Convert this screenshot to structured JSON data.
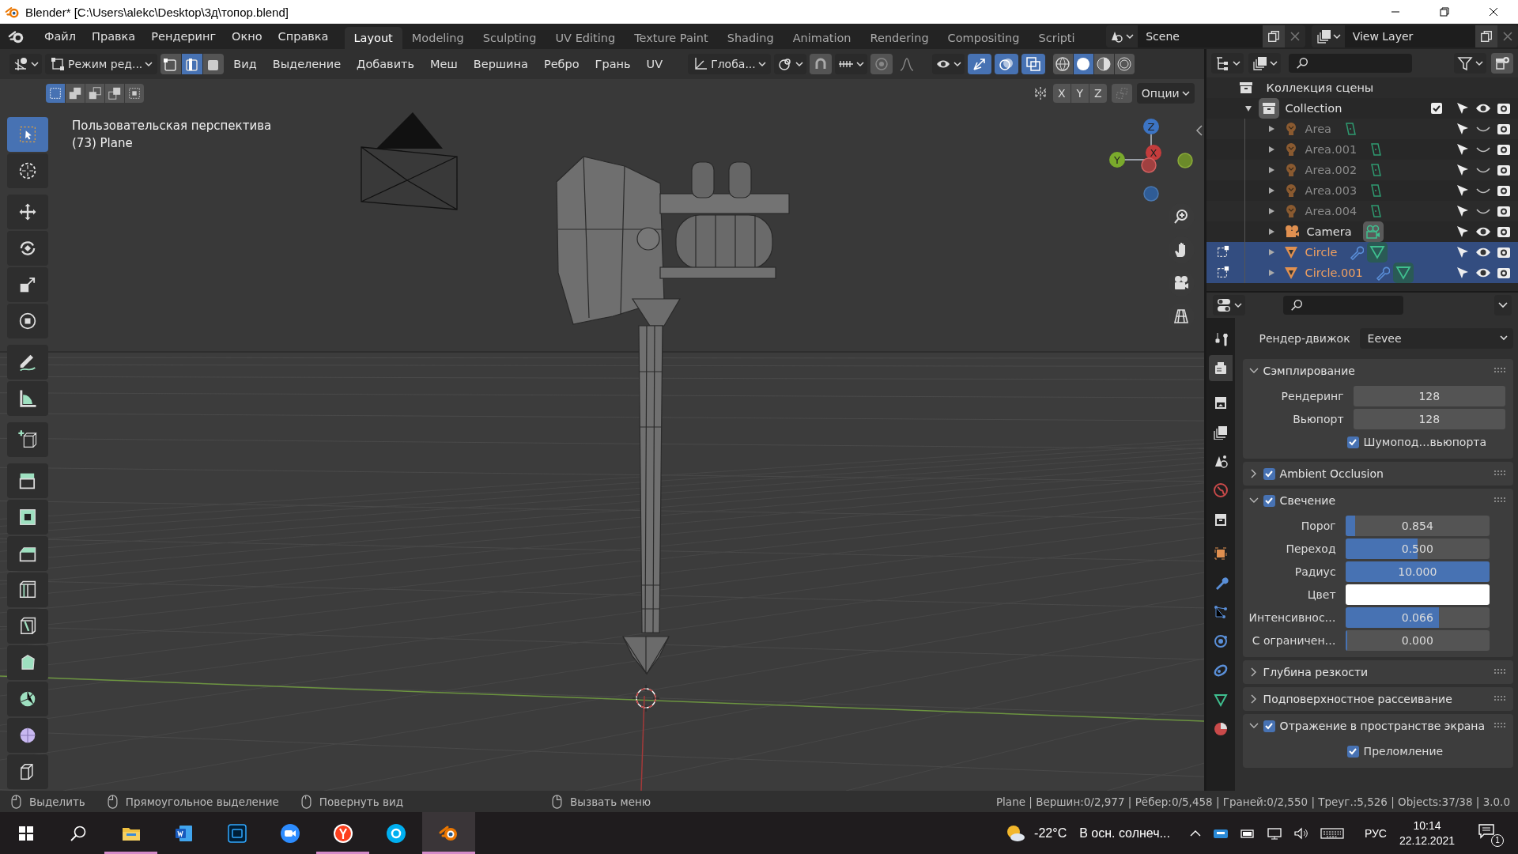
{
  "window": {
    "title": "Blender* [C:\\Users\\alekc\\Desktop\\3д\\топор.blend]"
  },
  "menu": [
    "Файл",
    "Правка",
    "Рендеринг",
    "Окно",
    "Справка"
  ],
  "workspaces": [
    {
      "label": "Layout",
      "selected": true
    },
    {
      "label": "Modeling",
      "selected": false
    },
    {
      "label": "Sculpting",
      "selected": false
    },
    {
      "label": "UV Editing",
      "selected": false
    },
    {
      "label": "Texture Paint",
      "selected": false
    },
    {
      "label": "Shading",
      "selected": false
    },
    {
      "label": "Animation",
      "selected": false
    },
    {
      "label": "Rendering",
      "selected": false
    },
    {
      "label": "Compositing",
      "selected": false
    },
    {
      "label": "Scripti",
      "selected": false
    }
  ],
  "scene": "Scene",
  "view_layer": "View Layer",
  "viewport": {
    "mode": "Режим ред...",
    "select_modes": [
      {
        "kind": "vertex",
        "selected": false
      },
      {
        "kind": "edge",
        "selected": true
      },
      {
        "kind": "face",
        "selected": false
      }
    ],
    "menus": [
      "Вид",
      "Выделение",
      "Добавить",
      "Меш",
      "Вершина",
      "Ребро",
      "Грань",
      "UV"
    ],
    "orientation": "Глоба...",
    "toggles": [
      {
        "kind": "gizmo",
        "on": true
      },
      {
        "kind": "overlays",
        "on": true
      },
      {
        "kind": "xray",
        "on": true
      }
    ],
    "shading": [
      {
        "kind": "wireframe",
        "selected": false
      },
      {
        "kind": "solid",
        "selected": true
      },
      {
        "kind": "material",
        "selected": false
      },
      {
        "kind": "rendered",
        "selected": false
      }
    ],
    "box_modes": [
      {
        "kind": "new",
        "selected": true
      },
      {
        "kind": "extend",
        "selected": false
      },
      {
        "kind": "subtract",
        "selected": false
      },
      {
        "kind": "invert",
        "selected": false
      },
      {
        "kind": "intersect",
        "selected": false
      }
    ],
    "mirror_axes": [
      {
        "label": "X",
        "on": false
      },
      {
        "label": "Y",
        "on": false
      },
      {
        "label": "Z",
        "on": false
      }
    ],
    "options": "Опции",
    "overlay_text": [
      "Пользовательская перспектива",
      "(73) Plane"
    ],
    "gizmo_axes": [
      "X",
      "Y",
      "Z"
    ],
    "tools": [
      [
        {
          "kind": "select-box",
          "selected": true
        },
        {
          "kind": "crosshair",
          "selected": false
        }
      ],
      [
        {
          "kind": "move",
          "selected": false
        },
        {
          "kind": "rotate",
          "selected": false
        },
        {
          "kind": "scale",
          "selected": false
        },
        {
          "kind": "transform",
          "selected": false
        }
      ],
      [
        {
          "kind": "pencil",
          "selected": false
        },
        {
          "kind": "ruler",
          "selected": false
        }
      ],
      [
        {
          "kind": "add-cube",
          "selected": false
        }
      ],
      [
        {
          "kind": "extrude",
          "selected": false
        },
        {
          "kind": "inset",
          "selected": false
        },
        {
          "kind": "bevel",
          "selected": false
        },
        {
          "kind": "loop-cut",
          "selected": false
        },
        {
          "kind": "knife",
          "selected": false
        },
        {
          "kind": "poly-build",
          "selected": false
        },
        {
          "kind": "spin",
          "selected": false
        },
        {
          "kind": "smooth",
          "selected": false
        },
        {
          "kind": "shear",
          "selected": false
        }
      ]
    ]
  },
  "outliner": {
    "root": "Коллекция сцены",
    "collection": {
      "name": "Collection",
      "included": true,
      "children": [
        {
          "name": "Area",
          "kind": "light",
          "visible": false,
          "selected": false,
          "editing": false,
          "modifier": false
        },
        {
          "name": "Area.001",
          "kind": "light",
          "visible": false,
          "selected": false,
          "editing": false,
          "modifier": false
        },
        {
          "name": "Area.002",
          "kind": "light",
          "visible": false,
          "selected": false,
          "editing": false,
          "modifier": false
        },
        {
          "name": "Area.003",
          "kind": "light",
          "visible": false,
          "selected": false,
          "editing": false,
          "modifier": false
        },
        {
          "name": "Area.004",
          "kind": "light",
          "visible": false,
          "selected": false,
          "editing": false,
          "modifier": false
        },
        {
          "name": "Camera",
          "kind": "camera",
          "visible": true,
          "selected": false,
          "editing": false,
          "modifier": false
        },
        {
          "name": "Circle",
          "kind": "mesh",
          "visible": true,
          "selected": true,
          "editing": true,
          "modifier": true
        },
        {
          "name": "Circle.001",
          "kind": "mesh",
          "visible": true,
          "selected": true,
          "editing": true,
          "modifier": true
        }
      ]
    }
  },
  "properties": {
    "tabs": [
      {
        "kind": "tool",
        "selected": false
      },
      {
        "kind": "render",
        "selected": true
      },
      {
        "kind": "output",
        "selected": false
      },
      {
        "kind": "view-layer",
        "selected": false
      },
      {
        "kind": "scene",
        "selected": false
      },
      {
        "kind": "world",
        "selected": false
      },
      {
        "kind": "collection",
        "selected": false
      },
      {
        "kind": "object",
        "selected": false
      },
      {
        "kind": "modifiers",
        "selected": false
      },
      {
        "kind": "particles",
        "selected": false
      },
      {
        "kind": "physics",
        "selected": false
      },
      {
        "kind": "constraints",
        "selected": false
      },
      {
        "kind": "data",
        "selected": false
      },
      {
        "kind": "material",
        "selected": false
      }
    ],
    "engine_label": "Рендер-движок",
    "engine": "Eevee",
    "panels": [
      {
        "title": "Сэмплирование",
        "expanded": true,
        "rows": [
          {
            "kind": "number",
            "label": "Рендеринг",
            "value": "128"
          },
          {
            "kind": "number",
            "label": "Вьюпорт",
            "value": "128"
          },
          {
            "kind": "checkbox",
            "label": "Шумопод…вьюпорта",
            "checked": true
          }
        ]
      },
      {
        "title": "Ambient Occlusion",
        "expanded": false,
        "checked": true
      },
      {
        "title": "Свечение",
        "expanded": true,
        "checked": true,
        "rows": [
          {
            "kind": "slider",
            "label": "Порог",
            "value": "0.854",
            "level": 0.07
          },
          {
            "kind": "slider",
            "label": "Переход",
            "value": "0.500",
            "level": 0.5
          },
          {
            "kind": "slider",
            "label": "Радиус",
            "value": "10.000",
            "level": 1
          },
          {
            "kind": "color",
            "label": "Цвет",
            "color": "#ffffff"
          },
          {
            "kind": "slider",
            "label": "Интенсивнос…",
            "value": "0.066",
            "level": 0.65
          },
          {
            "kind": "slider",
            "label": "С ограничен…",
            "value": "0.000",
            "level": 0
          }
        ]
      },
      {
        "title": "Глубина резкости",
        "expanded": false
      },
      {
        "title": "Подповерхностное рассеивание",
        "expanded": false
      },
      {
        "title": "Отражение в пространстве экрана",
        "expanded": true,
        "checked": true,
        "rows": [
          {
            "kind": "checkbox",
            "label": "Преломление",
            "checked": true
          }
        ]
      }
    ]
  },
  "status_bar": {
    "hints": [
      {
        "kind": "left",
        "label": "Выделить"
      },
      {
        "kind": "left-drag",
        "label": "Прямоугольное выделение"
      },
      {
        "kind": "middle",
        "label": "Повернуть вид"
      },
      {
        "kind": "right",
        "label": "Вызвать меню"
      }
    ],
    "stats": "Plane | Вершин:0/2,977 | Рёбер:0/5,458 | Граней:0/2,550 | Треуг.:5,526 | Objects:37/38 | 3.0.0"
  },
  "taskbar": {
    "apps": [
      {
        "kind": "folder",
        "open": true,
        "active": false
      },
      {
        "kind": "document",
        "open": false,
        "active": false
      },
      {
        "kind": "image-editor",
        "open": false,
        "active": false
      },
      {
        "kind": "video-call",
        "open": false,
        "active": false
      },
      {
        "kind": "browser",
        "open": true,
        "active": false
      },
      {
        "kind": "messenger",
        "open": false,
        "active": false
      },
      {
        "kind": "blender",
        "open": true,
        "active": true
      }
    ],
    "temperature": "-22°C",
    "weather": "В осн. солнеч...",
    "language": "РУС",
    "time": "10:14",
    "date": "22.12.2021",
    "notifications": "1"
  }
}
